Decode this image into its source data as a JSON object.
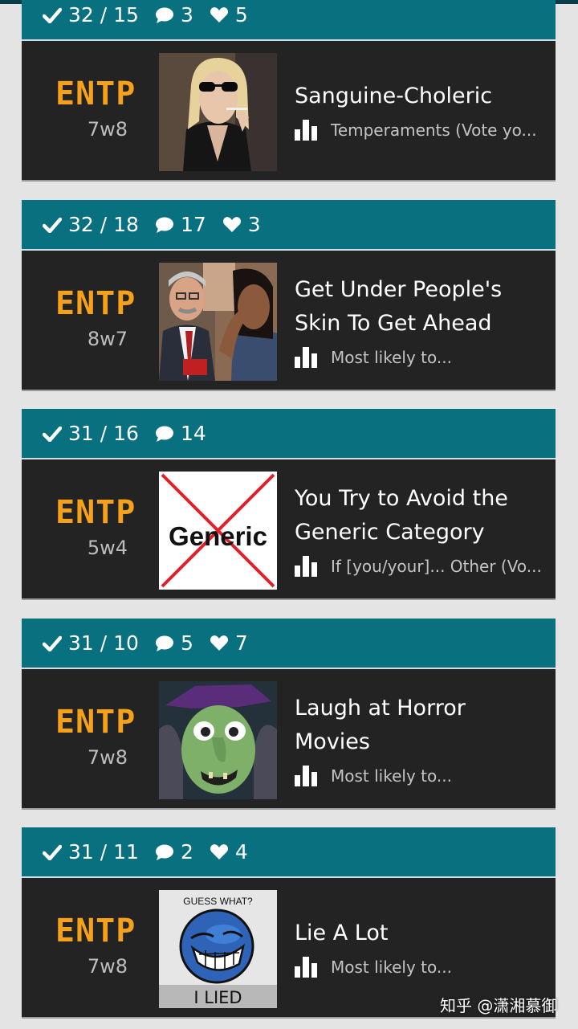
{
  "cards": [
    {
      "stats": {
        "votes": "32 / 15",
        "comments": "3",
        "likes": "5"
      },
      "type": "ENTP",
      "wing": "7w8",
      "title": "Sanguine-Choleric",
      "category": "Temperaments (Vote yo..."
    },
    {
      "stats": {
        "votes": "32 / 18",
        "comments": "17",
        "likes": "3"
      },
      "type": "ENTP",
      "wing": "8w7",
      "title": "Get Under People's Skin To Get Ahead",
      "category": "Most likely to..."
    },
    {
      "stats": {
        "votes": "31 / 16",
        "comments": "14"
      },
      "type": "ENTP",
      "wing": "5w4",
      "title": "You Try to Avoid the Generic Category",
      "category": "If [you/your]... Other (Vo...",
      "image_text": "Generic"
    },
    {
      "stats": {
        "votes": "31 / 10",
        "comments": "5",
        "likes": "7"
      },
      "type": "ENTP",
      "wing": "7w8",
      "title": "Laugh at Horror Movies",
      "category": "Most likely to..."
    },
    {
      "stats": {
        "votes": "31 / 11",
        "comments": "2",
        "likes": "4"
      },
      "type": "ENTP",
      "wing": "7w8",
      "title": "Lie A Lot",
      "category": "Most likely to...",
      "image_text_top": "GUESS WHAT?",
      "image_text_bottom": "I LIED"
    }
  ],
  "watermark": "知乎 @潇湘慕御",
  "colors": {
    "header": "#08707f",
    "body": "#232323",
    "type": "#f5a11a",
    "background": "#e4e4e4"
  },
  "icons": [
    "check-icon",
    "comment-icon",
    "heart-icon",
    "bar-chart-icon"
  ]
}
